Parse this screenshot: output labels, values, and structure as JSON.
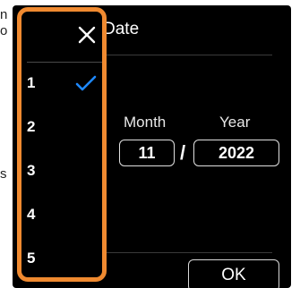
{
  "background": {
    "top_text_1": "n",
    "top_text_2": "o",
    "side_text": "s"
  },
  "dialog": {
    "title": "Date",
    "month_label": "Month",
    "year_label": "Year",
    "month_value": "11",
    "separator": "/",
    "year_value": "2022",
    "ok_label": "OK"
  },
  "picker": {
    "close_icon": "close-icon",
    "selected_icon": "checkmark-icon",
    "accent_color": "#f08a30",
    "check_color": "#1e88ff",
    "items": [
      {
        "label": "1",
        "selected": true
      },
      {
        "label": "2",
        "selected": false
      },
      {
        "label": "3",
        "selected": false
      },
      {
        "label": "4",
        "selected": false
      },
      {
        "label": "5",
        "selected": false
      }
    ]
  }
}
